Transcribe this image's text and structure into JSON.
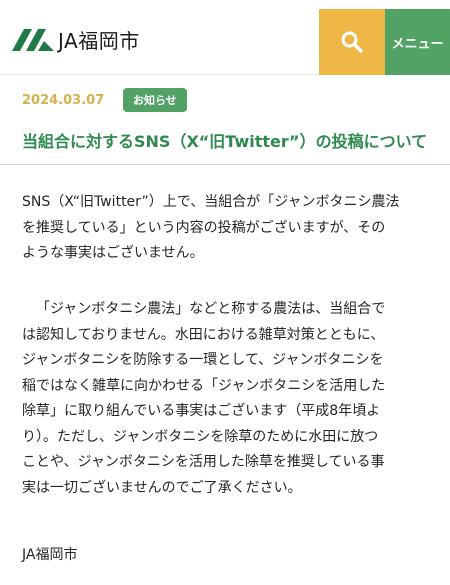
{
  "header": {
    "logo_text": "JA福岡市",
    "menu_label": "メニュー",
    "search_icon": "search-icon",
    "colors": {
      "search_bg": "#eeb746",
      "menu_bg": "#52a266",
      "accent_green": "#2f8a4f"
    }
  },
  "article": {
    "date": "2024.03.07",
    "category": "お知らせ",
    "title": "当組合に対するSNS（X“旧Twitter”）の投稿について",
    "paragraph1": [
      "SNS（X“旧Twitter”）上で、当組合が「ジャンボタニシ農法",
      "を推奨している」という内容の投稿がございますが、その",
      "ような事実はございません。"
    ],
    "paragraph2": [
      "「ジャンボタニシ農法」などと称する農法は、当組合で",
      "は認知しておりません。水田における雑草対策とともに、",
      "ジャンボタニシを防除する一環として、ジャンボタニシを",
      "稲ではなく雑草に向かわせる「ジャンボタニシを活用した",
      "除草」に取り組んでいる事実はございます（平成8年頃よ",
      "り）。ただし、ジャンボタニシを除草のために水田に放つ",
      "ことや、ジャンボタニシを活用した除草を推奨している事",
      "実は一切ございませんのでご了承ください。"
    ],
    "signature": "JA福岡市"
  }
}
